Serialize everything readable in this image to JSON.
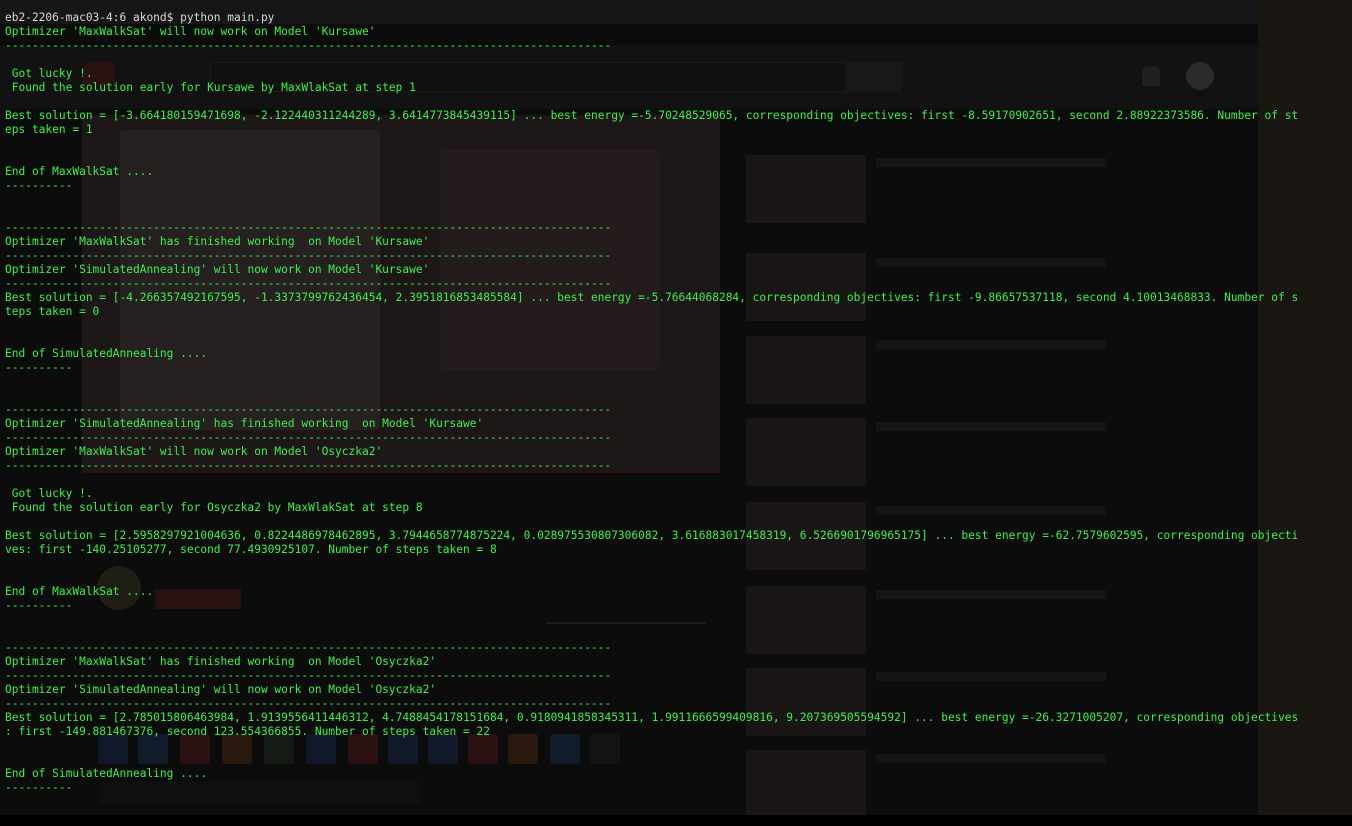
{
  "prompt": "eb2-2206-mac03-4:6 akond$ python main.py",
  "lines": [
    "Optimizer 'MaxWalkSat' will now work on Model 'Kursawe'",
    "------------------------------------------------------------------------------------------",
    "",
    " Got lucky !.",
    " Found the solution early for Kursawe by MaxWlakSat at step 1",
    "",
    "Best solution = [-3.664180159471698, -2.122440311244289, 3.6414773845439115] ... best energy =-5.70248529065, corresponding objectives: first -8.59170902651, second 2.88922373586. Number of st",
    "eps taken = 1",
    "",
    "",
    "End of MaxWalkSat ....",
    "----------",
    "",
    "",
    "------------------------------------------------------------------------------------------",
    "Optimizer 'MaxWalkSat' has finished working  on Model 'Kursawe'",
    "------------------------------------------------------------------------------------------",
    "Optimizer 'SimulatedAnnealing' will now work on Model 'Kursawe'",
    "------------------------------------------------------------------------------------------",
    "Best solution = [-4.266357492167595, -1.3373799762436454, 2.3951816853485584] ... best energy =-5.76644068284, corresponding objectives: first -9.86657537118, second 4.10013468833. Number of s",
    "teps taken = 0",
    "",
    "",
    "End of SimulatedAnnealing ....",
    "----------",
    "",
    "",
    "------------------------------------------------------------------------------------------",
    "Optimizer 'SimulatedAnnealing' has finished working  on Model 'Kursawe'",
    "------------------------------------------------------------------------------------------",
    "Optimizer 'MaxWalkSat' will now work on Model 'Osyczka2'",
    "------------------------------------------------------------------------------------------",
    "",
    " Got lucky !.",
    " Found the solution early for Osyczka2 by MaxWlakSat at step 8",
    "",
    "Best solution = [2.5958297921004636, 0.8224486978462895, 3.7944658774875224, 0.028975530807306082, 3.616883017458319, 6.5266901796965175] ... best energy =-62.7579602595, corresponding objecti",
    "ves: first -140.25105277, second 77.4930925107. Number of steps taken = 8",
    "",
    "",
    "End of MaxWalkSat ....",
    "----------",
    "",
    "",
    "------------------------------------------------------------------------------------------",
    "Optimizer 'MaxWalkSat' has finished working  on Model 'Osyczka2'",
    "------------------------------------------------------------------------------------------",
    "Optimizer 'SimulatedAnnealing' will now work on Model 'Osyczka2'",
    "------------------------------------------------------------------------------------------",
    "Best solution = [2.785015806463984, 1.9139556411446312, 4.7488454178151684, 0.9180941858345311, 1.9911666599409816, 9.207369505594592] ... best energy =-26.3271005207, corresponding objectives",
    ": first -149.881467376, second 123.554366855. Number of steps taken = 22",
    "",
    "",
    "End of SimulatedAnnealing ....",
    "----------"
  ],
  "colors": {
    "terminal_text": "#3af24a",
    "prompt_text": "#d8d8d8",
    "background": "#000000"
  }
}
